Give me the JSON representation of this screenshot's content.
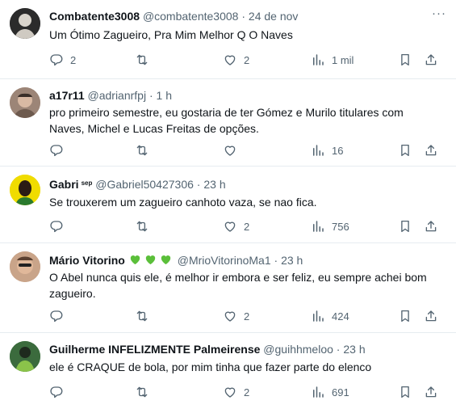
{
  "tweets": [
    {
      "name": "Combatente3008",
      "handle": "@combatente3008",
      "dot": "·",
      "time": "24 de nov",
      "text": "Um Ótimo Zagueiro, Pra Mim Melhor Q O Naves",
      "replies": "2",
      "retweets": "",
      "likes": "2",
      "views": "1 mil",
      "more": "···",
      "avatar_color": "#3b3b3b"
    },
    {
      "name": "a17r11",
      "handle": "@adrianrfpj",
      "dot": "·",
      "time": "1 h",
      "text": "pro primeiro semestre, eu gostaria de ter Gómez e Murilo titulares com Naves, Michel e Lucas Freitas de opções.",
      "replies": "",
      "retweets": "",
      "likes": "",
      "views": "16",
      "avatar_color": "#b59a8a"
    },
    {
      "name": "Gabri",
      "badge": "sep",
      "handle": "@Gabriel50427306",
      "dot": "·",
      "time": "23 h",
      "text": "Se trouxerem um zagueiro canhoto vaza, se nao fica.",
      "replies": "",
      "retweets": "",
      "likes": "2",
      "views": "756",
      "avatar_color": "#e6d200"
    },
    {
      "name": "Mário Vitorino",
      "handle": "@MrioVitorinoMa1",
      "dot": "·",
      "time": "23 h",
      "text": "O Abel nunca quis ele, é melhor ir embora e ser feliz, eu sempre achei bom zagueiro.",
      "replies": "",
      "retweets": "",
      "likes": "2",
      "views": "424",
      "heart_color": "#5bbf3a",
      "avatar_color": "#c9a489"
    },
    {
      "name": "Guilherme INFELIZMENTE Palmeirense",
      "handle": "@guihhmeloo",
      "dot": "·",
      "time": "23 h",
      "text": "ele é CRAQUE de bola, por mim tinha que fazer parte do elenco",
      "replies": "",
      "retweets": "",
      "likes": "2",
      "views": "691",
      "avatar_color": "#2e7d32"
    }
  ],
  "colors": {
    "text": "#0f1419",
    "muted": "#536471",
    "divider": "#e6ecf0"
  },
  "icons": [
    "reply-icon",
    "retweet-icon",
    "like-icon",
    "views-icon",
    "bookmark-icon",
    "share-icon",
    "more-icon"
  ]
}
